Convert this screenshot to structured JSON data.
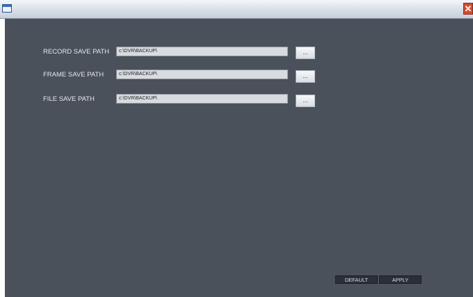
{
  "window": {
    "title": "",
    "close_glyph": "✕",
    "icons": {
      "window_icon": "window-icon",
      "close_icon": "close-icon",
      "browse_icon": "ellipsis"
    }
  },
  "paths": [
    {
      "label": "RECORD SAVE PATH",
      "value": "c:\\DVR\\BACKUP\\",
      "browse_label": "..."
    },
    {
      "label": "FRAME SAVE PATH",
      "value": "c:\\DVR\\BACKUP\\",
      "browse_label": "..."
    },
    {
      "label": "FILE SAVE PATH",
      "value": "c:\\DVR\\BACKUP\\",
      "browse_label": "..."
    }
  ],
  "footer": {
    "default_label": "DEFAULT",
    "apply_label": "APPLY"
  },
  "colors": {
    "panel_bg": "#4a515b",
    "close_red": "#d64b2e",
    "button_dark": "#2b3038"
  }
}
